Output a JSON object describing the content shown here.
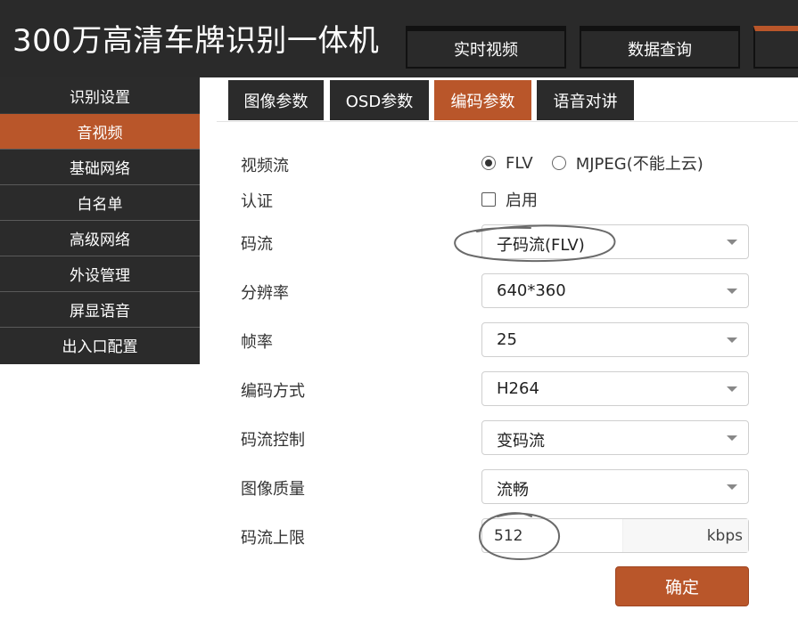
{
  "header": {
    "title": "300万高清车牌识别一体机",
    "nav": [
      "实时视频",
      "数据查询",
      ""
    ]
  },
  "sidebar": {
    "items": [
      {
        "label": "识别设置",
        "active": false
      },
      {
        "label": "音视频",
        "active": true
      },
      {
        "label": "基础网络",
        "active": false
      },
      {
        "label": "白名单",
        "active": false
      },
      {
        "label": "高级网络",
        "active": false
      },
      {
        "label": "外设管理",
        "active": false
      },
      {
        "label": "屏显语音",
        "active": false
      },
      {
        "label": "出入口配置",
        "active": false
      }
    ]
  },
  "tabs": [
    {
      "label": "图像参数",
      "active": false
    },
    {
      "label": "OSD参数",
      "active": false
    },
    {
      "label": "编码参数",
      "active": true
    },
    {
      "label": "语音对讲",
      "active": false
    }
  ],
  "form": {
    "video_stream": {
      "label": "视频流",
      "options": [
        {
          "label": "FLV",
          "checked": true
        },
        {
          "label": "MJPEG(不能上云)",
          "checked": false
        }
      ]
    },
    "auth": {
      "label": "认证",
      "checkbox_label": "启用",
      "checked": false
    },
    "stream": {
      "label": "码流",
      "value": "子码流(FLV)"
    },
    "resolution": {
      "label": "分辨率",
      "value": "640*360"
    },
    "frame_rate": {
      "label": "帧率",
      "value": "25"
    },
    "encoding": {
      "label": "编码方式",
      "value": "H264"
    },
    "rate_control": {
      "label": "码流控制",
      "value": "变码流"
    },
    "image_quality": {
      "label": "图像质量",
      "value": "流畅"
    },
    "bitrate_limit": {
      "label": "码流上限",
      "value": "512",
      "unit": "kbps"
    },
    "confirm_label": "确定"
  },
  "colors": {
    "accent": "#b9562a",
    "dark": "#2a2a2a"
  }
}
